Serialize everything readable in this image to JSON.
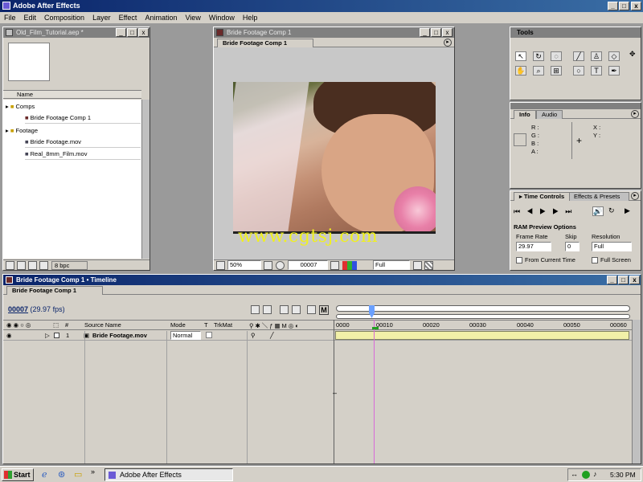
{
  "app": {
    "title": "Adobe After Effects"
  },
  "menu": [
    "File",
    "Edit",
    "Composition",
    "Layer",
    "Effect",
    "Animation",
    "View",
    "Window",
    "Help"
  ],
  "project": {
    "title": "Old_Film_Tutorial.aep *",
    "column_name": "Name",
    "items": [
      {
        "label": "Comps",
        "type": "folder",
        "indent": 0
      },
      {
        "label": "Bride Footage Comp 1",
        "type": "comp",
        "indent": 1
      },
      {
        "label": "Footage",
        "type": "folder",
        "indent": 0
      },
      {
        "label": "Bride Footage.mov",
        "type": "footage",
        "indent": 1
      },
      {
        "label": "Real_8mm_Film.mov",
        "type": "footage",
        "indent": 1
      }
    ],
    "bpc": "8 bpc"
  },
  "comp_window": {
    "title": "Bride Footage Comp 1",
    "tab": "Bride Footage Comp 1",
    "watermark": "www.cgtsj.com",
    "zoom": "50%",
    "timecode": "00007",
    "resolution": "Full"
  },
  "tools": {
    "title": "Tools"
  },
  "info": {
    "tabs": [
      "Info",
      "Audio"
    ],
    "rgba": [
      "R :",
      "G :",
      "B :",
      "A :"
    ],
    "xy": [
      "X :",
      "Y :"
    ]
  },
  "time_controls": {
    "tabs": [
      "Time Controls",
      "Effects & Presets"
    ],
    "ram_title": "RAM Preview Options",
    "frame_rate_label": "Frame Rate",
    "frame_rate": "29.97",
    "skip_label": "Skip",
    "skip": "0",
    "resolution_label": "Resolution",
    "resolution": "Full",
    "from_current": "From Current Time",
    "full_screen": "Full Screen"
  },
  "timeline": {
    "title": "Bride Footage Comp 1 • Timeline",
    "tab": "Bride Footage Comp 1",
    "timecode": "00007",
    "fps": "(29.97 fps)",
    "cols": {
      "num": "#",
      "source": "Source Name",
      "mode": "Mode",
      "t": "T",
      "trkmat": "TrkMat"
    },
    "ruler": [
      "0000",
      "00010",
      "00020",
      "00030",
      "00040",
      "00050",
      "00060"
    ],
    "layer": {
      "num": "1",
      "name": "Bride Footage.mov",
      "mode": "Normal"
    }
  },
  "taskbar": {
    "start": "Start",
    "task": "Adobe After Effects",
    "clock": "5:30 PM"
  },
  "colors": {
    "accent": "#0a246a",
    "panel": "#d4d0c8",
    "watermark": "#f0f020"
  }
}
